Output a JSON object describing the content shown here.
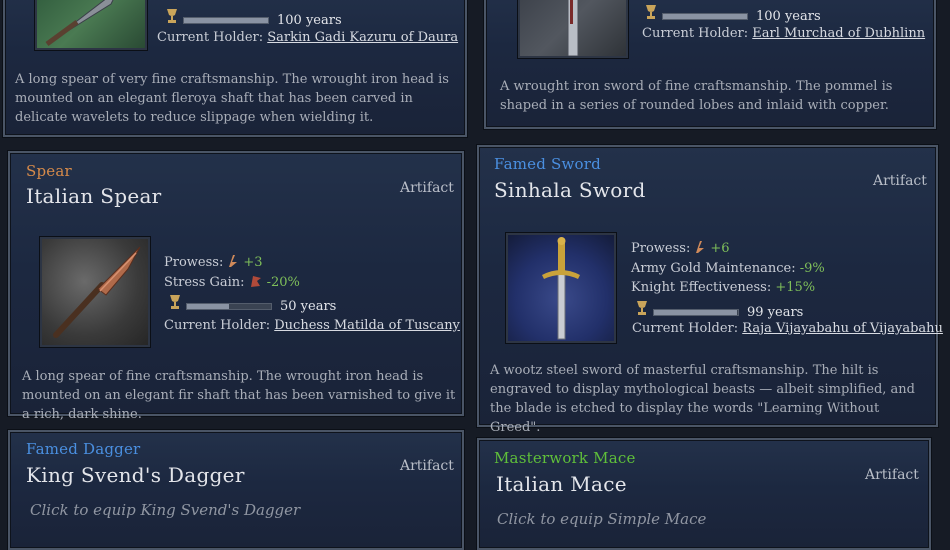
{
  "cards": {
    "top_left": {
      "durability_label": "100 years",
      "durability_fraction": 1.0,
      "holder_label": "Current Holder:",
      "holder_name": "Sarkin Gadi Kazuru of Daura",
      "description": "A long spear of very fine craftsmanship. The wrought iron head is mounted on an elegant fleroya shaft that has been carved in delicate wavelets to reduce slippage when wielding it."
    },
    "top_right": {
      "durability_label": "100 years",
      "durability_fraction": 1.0,
      "holder_label": "Current Holder:",
      "holder_name": "Earl Murchad of Dubhlinn",
      "description": "A wrought iron sword of fine craftsmanship. The pommel is shaped in a series of rounded lobes and inlaid with copper."
    },
    "spear": {
      "category": "Spear",
      "category_color": "#d68a4a",
      "title": "Italian Spear",
      "rarity": "Artifact",
      "prowess_label": "Prowess:",
      "prowess_value": "+3",
      "stress_label": "Stress Gain:",
      "stress_value": "-20%",
      "durability_label": "50 years",
      "durability_fraction": 0.5,
      "holder_label": "Current Holder:",
      "holder_name": "Duchess Matilda of Tuscany",
      "description": "A long spear of fine craftsmanship. The wrought iron head is mounted on an elegant fir shaft that has been varnished to give it a rich, dark shine."
    },
    "sword": {
      "category": "Famed Sword",
      "category_color": "#4a8fe0",
      "title": "Sinhala Sword",
      "rarity": "Artifact",
      "prowess_label": "Prowess:",
      "prowess_value": "+6",
      "gold_label": "Army Gold Maintenance:",
      "gold_value": "-9%",
      "knight_label": "Knight Effectiveness:",
      "knight_value": "+15%",
      "durability_label": "99 years",
      "durability_fraction": 0.99,
      "holder_label": "Current Holder:",
      "holder_name": "Raja Vijayabahu of Vijayabahu",
      "description": "A wootz steel sword of masterful craftsmanship. The hilt is engraved to display mythological beasts — albeit simplified, and the blade is etched to display the words \"Learning Without Greed\"."
    },
    "dagger": {
      "category": "Famed Dagger",
      "category_color": "#4a8fe0",
      "title": "King Svend's Dagger",
      "rarity": "Artifact",
      "hint": "Click to equip King Svend's Dagger"
    },
    "mace": {
      "category": "Masterwork Mace",
      "category_color": "#5fbf3a",
      "title": "Italian  Mace",
      "rarity": "Artifact",
      "hint": "Click to equip Simple Mace"
    }
  }
}
